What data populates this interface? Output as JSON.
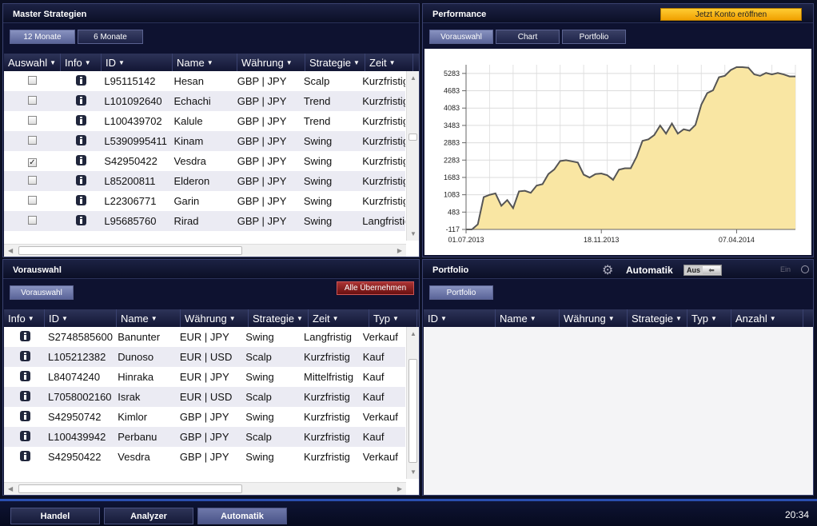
{
  "panels": {
    "master": {
      "title": "Master Strategien",
      "tabs": [
        "12 Monate",
        "6 Monate"
      ],
      "columns": [
        "Auswahl",
        "Info",
        "ID",
        "Name",
        "Währung",
        "Strategie",
        "Zeit"
      ],
      "rows": [
        {
          "checked": false,
          "id": "L95115142",
          "name": "Hesan",
          "currency": "GBP | JPY",
          "strategy": "Scalp",
          "time": "Kurzfristig"
        },
        {
          "checked": false,
          "id": "L101092640",
          "name": "Echachi",
          "currency": "GBP | JPY",
          "strategy": "Trend",
          "time": "Kurzfristig"
        },
        {
          "checked": false,
          "id": "L100439702",
          "name": "Kalule",
          "currency": "GBP | JPY",
          "strategy": "Trend",
          "time": "Kurzfristig"
        },
        {
          "checked": false,
          "id": "L5390995411",
          "name": "Kinam",
          "currency": "GBP | JPY",
          "strategy": "Swing",
          "time": "Kurzfristig"
        },
        {
          "checked": true,
          "id": "S42950422",
          "name": "Vesdra",
          "currency": "GBP | JPY",
          "strategy": "Swing",
          "time": "Kurzfristig"
        },
        {
          "checked": false,
          "id": "L85200811",
          "name": "Elderon",
          "currency": "GBP | JPY",
          "strategy": "Swing",
          "time": "Kurzfristig"
        },
        {
          "checked": false,
          "id": "L22306771",
          "name": "Garin",
          "currency": "GBP | JPY",
          "strategy": "Swing",
          "time": "Kurzfristig"
        },
        {
          "checked": false,
          "id": "L95685760",
          "name": "Rirad",
          "currency": "GBP | JPY",
          "strategy": "Swing",
          "time": "Langfristig"
        }
      ]
    },
    "performance": {
      "title": "Performance",
      "cta_label": "Jetzt Konto eröffnen",
      "tabs": [
        "Vorauswahl",
        "Chart",
        "Portfolio"
      ]
    },
    "vorauswahl": {
      "title": "Vorauswahl",
      "tab": "Vorauswahl",
      "apply_label": "Alle Übernehmen",
      "columns": [
        "Info",
        "ID",
        "Name",
        "Währung",
        "Strategie",
        "Zeit",
        "Typ"
      ],
      "rows": [
        {
          "id": "S2748585600",
          "name": "Banunter",
          "currency": "EUR | JPY",
          "strategy": "Swing",
          "time": "Langfristig",
          "type": "Verkauf"
        },
        {
          "id": "L105212382",
          "name": "Dunoso",
          "currency": "EUR | USD",
          "strategy": "Scalp",
          "time": "Kurzfristig",
          "type": "Kauf"
        },
        {
          "id": "L84074240",
          "name": "Hinraka",
          "currency": "EUR | JPY",
          "strategy": "Swing",
          "time": "Mittelfristig",
          "type": "Kauf"
        },
        {
          "id": "L7058002160",
          "name": "Israk",
          "currency": "EUR | USD",
          "strategy": "Scalp",
          "time": "Kurzfristig",
          "type": "Kauf"
        },
        {
          "id": "S42950742",
          "name": "Kimlor",
          "currency": "GBP | JPY",
          "strategy": "Swing",
          "time": "Kurzfristig",
          "type": "Verkauf"
        },
        {
          "id": "L100439942",
          "name": "Perbanu",
          "currency": "GBP | JPY",
          "strategy": "Scalp",
          "time": "Kurzfristig",
          "type": "Kauf"
        },
        {
          "id": "S42950422",
          "name": "Vesdra",
          "currency": "GBP | JPY",
          "strategy": "Swing",
          "time": "Kurzfristig",
          "type": "Verkauf"
        }
      ]
    },
    "portfolio": {
      "title": "Portfolio",
      "auto_label": "Automatik",
      "toggle_off": "Aus",
      "toggle_on": "Ein",
      "tab": "Portfolio",
      "columns": [
        "ID",
        "Name",
        "Währung",
        "Strategie",
        "Typ",
        "Anzahl"
      ]
    }
  },
  "chart_data": {
    "type": "area",
    "ylim": [
      -117,
      5583
    ],
    "yticks": [
      -117,
      483,
      1083,
      1683,
      2283,
      2883,
      3483,
      4083,
      4683,
      5283
    ],
    "xticks": [
      "01.07.2013",
      "18.11.2013",
      "07.04.2014"
    ],
    "x_index_of_ticks": [
      0,
      23,
      46
    ],
    "color_fill": "#f9e6a3",
    "color_line": "#555555",
    "values": [
      -117,
      -117,
      60,
      1000,
      1080,
      1130,
      700,
      900,
      620,
      1200,
      1220,
      1150,
      1400,
      1450,
      1800,
      1960,
      2250,
      2280,
      2240,
      2200,
      1780,
      1680,
      1800,
      1820,
      1760,
      1600,
      1950,
      2000,
      2000,
      2400,
      2950,
      3000,
      3150,
      3480,
      3200,
      3550,
      3200,
      3350,
      3300,
      3500,
      4200,
      4600,
      4700,
      5150,
      5200,
      5400,
      5500,
      5500,
      5480,
      5250,
      5200,
      5300,
      5250,
      5300,
      5250,
      5180,
      5180
    ]
  },
  "bottom": {
    "tabs": [
      "Handel",
      "Analyzer",
      "Automatik"
    ],
    "active": 2,
    "clock": "20:34"
  }
}
